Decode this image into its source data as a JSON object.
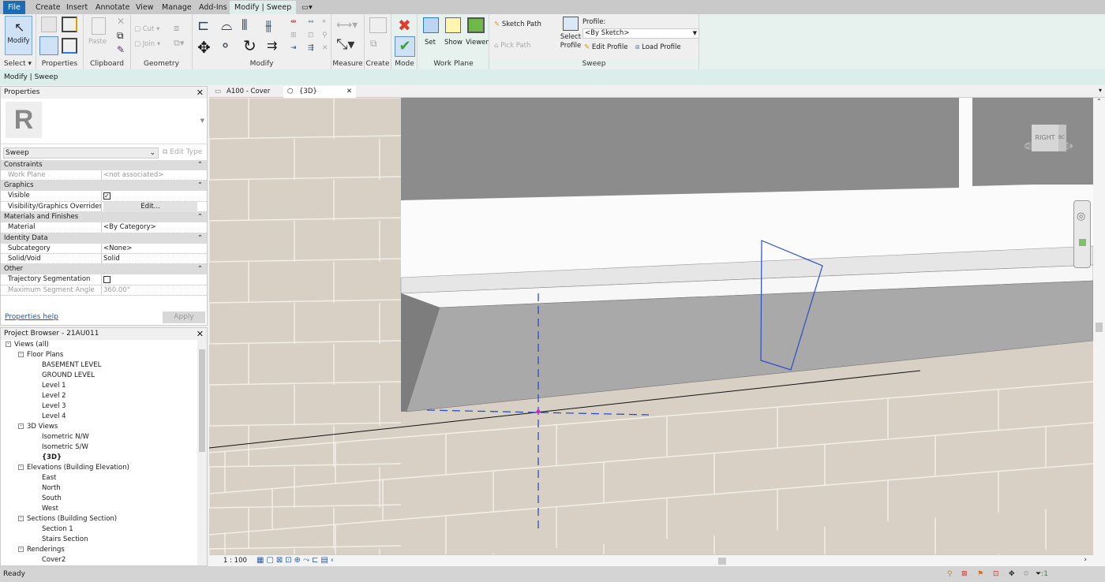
{
  "menu_tabs": [
    "File",
    "Create",
    "Insert",
    "Annotate",
    "View",
    "Manage",
    "Add-Ins",
    "Modify | Sweep"
  ],
  "ribbon": {
    "select": {
      "modify": "Modify",
      "label": "Select ▾"
    },
    "properties": {
      "label": "Properties"
    },
    "clipboard": {
      "paste": "Paste",
      "label": "Clipboard"
    },
    "geometry": {
      "cut": "Cut",
      "join": "Join",
      "label": "Geometry"
    },
    "modify": {
      "label": "Modify"
    },
    "measure": {
      "label": "Measure"
    },
    "create": {
      "label": "Create"
    },
    "mode": {
      "label": "Mode"
    },
    "work_plane": {
      "set": "Set",
      "show": "Show",
      "viewer": "Viewer",
      "label": "Work Plane"
    },
    "sweep": {
      "sketch_path": "Sketch Path",
      "pick_path": "Pick Path",
      "select_profile": "Select Profile",
      "profile_label": "Profile:",
      "profile_value": "<By Sketch>",
      "edit_profile": "Edit Profile",
      "load_profile": "Load Profile",
      "label": "Sweep"
    }
  },
  "context_bar": "Modify | Sweep",
  "properties": {
    "title": "Properties",
    "type": "Sweep",
    "edit_type": "Edit Type",
    "groups": [
      {
        "name": "Constraints",
        "rows": [
          {
            "k": "Work Plane",
            "v": "<not associated>",
            "greyed": true
          }
        ]
      },
      {
        "name": "Graphics",
        "rows": [
          {
            "k": "Visible",
            "v": "",
            "checkbox": true,
            "checked": true
          },
          {
            "k": "Visibility/Graphics Overrides",
            "v": "Edit...",
            "button": true
          }
        ]
      },
      {
        "name": "Materials and Finishes",
        "rows": [
          {
            "k": "Material",
            "v": "<By Category>"
          }
        ]
      },
      {
        "name": "Identity Data",
        "rows": [
          {
            "k": "Subcategory",
            "v": "<None>"
          },
          {
            "k": "Solid/Void",
            "v": "Solid"
          }
        ]
      },
      {
        "name": "Other",
        "rows": [
          {
            "k": "Trajectory Segmentation",
            "v": "",
            "checkbox": true,
            "checked": false
          },
          {
            "k": "Maximum Segment Angle",
            "v": "360.00°",
            "greyed": true
          }
        ]
      }
    ],
    "help": "Properties help",
    "apply": "Apply"
  },
  "project_browser": {
    "title": "Project Browser - 21AU011",
    "items": [
      {
        "level": 0,
        "label": "Views (all)",
        "exp": "-"
      },
      {
        "level": 1,
        "label": "Floor Plans",
        "exp": "-"
      },
      {
        "level": 2,
        "label": "BASEMENT LEVEL"
      },
      {
        "level": 2,
        "label": "GROUND LEVEL"
      },
      {
        "level": 2,
        "label": "Level 1"
      },
      {
        "level": 2,
        "label": "Level 2"
      },
      {
        "level": 2,
        "label": "Level 3"
      },
      {
        "level": 2,
        "label": "Level 4"
      },
      {
        "level": 1,
        "label": "3D Views",
        "exp": "-"
      },
      {
        "level": 2,
        "label": "Isometric N/W"
      },
      {
        "level": 2,
        "label": "Isometric S/W"
      },
      {
        "level": 2,
        "label": "{3D}",
        "bold": true
      },
      {
        "level": 1,
        "label": "Elevations (Building Elevation)",
        "exp": "-"
      },
      {
        "level": 2,
        "label": "East"
      },
      {
        "level": 2,
        "label": "North"
      },
      {
        "level": 2,
        "label": "South"
      },
      {
        "level": 2,
        "label": "West"
      },
      {
        "level": 1,
        "label": "Sections (Building Section)",
        "exp": "-"
      },
      {
        "level": 2,
        "label": "Section 1"
      },
      {
        "level": 2,
        "label": "Stairs Section"
      },
      {
        "level": 1,
        "label": "Renderings",
        "exp": "-"
      },
      {
        "level": 2,
        "label": "Cover2"
      }
    ]
  },
  "view_tabs": [
    {
      "label": "A100 - Cover",
      "active": false
    },
    {
      "label": "{3D}",
      "active": true
    }
  ],
  "viewcube": {
    "face": "RIGHT",
    "side": "BC"
  },
  "view_bar": {
    "scale": "1 : 100"
  },
  "status": {
    "text": "Ready",
    "filter_count": ":1"
  },
  "colors": {
    "file_tab": "#1b6bb8",
    "context": "#dceee9",
    "wall": "#d8d0c4",
    "sketch_line": "#2b4fc4",
    "finish": "#3ca13c",
    "cancel": "#e03c2c"
  }
}
